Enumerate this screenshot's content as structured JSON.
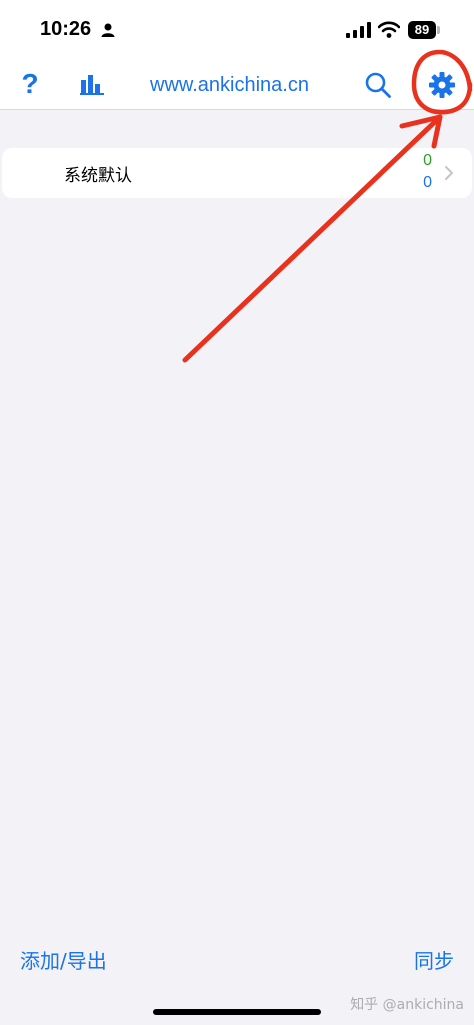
{
  "status_bar": {
    "time": "10:26",
    "battery": "89",
    "icons": [
      "person-icon",
      "signal-icon",
      "wifi-icon",
      "battery-icon"
    ]
  },
  "nav": {
    "title": "www.ankichina.cn",
    "help_label": "?",
    "icons": [
      "help-icon",
      "stats-icon",
      "search-icon",
      "settings-icon"
    ],
    "accent_color": "#1a73e8"
  },
  "deck": {
    "name": "系统默认",
    "new_count": "0",
    "due_count": "0",
    "new_color": "#2aa12a",
    "due_color": "#1a73e8"
  },
  "annotation": {
    "color": "#e8321e",
    "shape": "circle-and-arrow pointing to settings-icon"
  },
  "bottom_bar": {
    "add_export_label": "添加/导出",
    "sync_label": "同步"
  },
  "watermark": "知乎 @ankichina"
}
